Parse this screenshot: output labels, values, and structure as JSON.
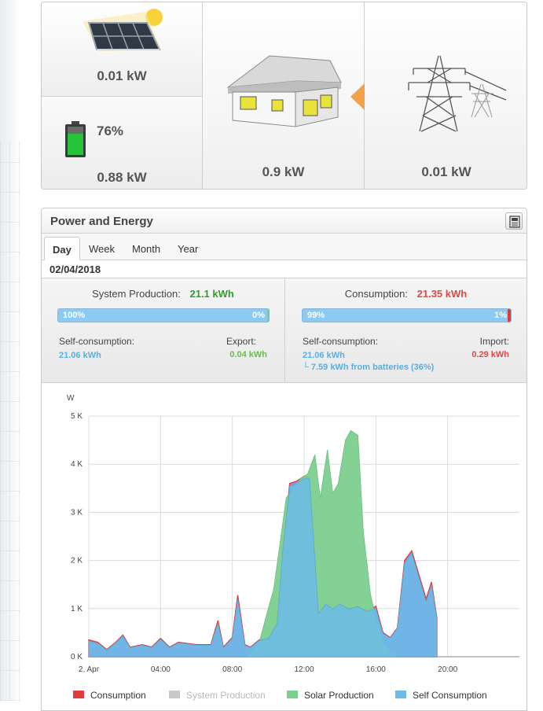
{
  "flow": {
    "solar_value": "0.01 kW",
    "battery_percent": "76%",
    "battery_value": "0.88 kW",
    "house_value": "0.9 kW",
    "grid_value": "0.01 kW"
  },
  "panel": {
    "title": "Power and Energy",
    "tabs": [
      "Day",
      "Week",
      "Month",
      "Year"
    ],
    "active_tab": "Day",
    "date": "02/04/2018"
  },
  "production": {
    "label": "System Production:",
    "value": "21.1 kWh",
    "bar_left": "100%",
    "bar_right": "0%",
    "self_label": "Self-consumption:",
    "self_value": "21.06 kWh",
    "export_label": "Export:",
    "export_value": "0.04 kWh"
  },
  "consumption": {
    "label": "Consumption:",
    "value": "21.35 kWh",
    "bar_left": "99%",
    "bar_right": "1%",
    "self_label": "Self-consumption:",
    "self_value": "21.06 kWh",
    "battery_note": "└ 7.59 kWh from batteries (36%)",
    "import_label": "Import:",
    "import_value": "0.29 kWh"
  },
  "colors": {
    "consumption": "#e03c3c",
    "system_production": "#c8c8c8",
    "solar_production": "#7ccf8f",
    "self_consumption": "#6bbbe9",
    "green_text": "#2e9e2e",
    "red_text": "#e04848",
    "blue_text": "#5aaee0",
    "lightgreen_text": "#6dbb4a"
  },
  "chart_data": {
    "type": "area",
    "ylabel": "W",
    "y_ticks": [
      "0 K",
      "1 K",
      "2 K",
      "3 K",
      "4 K",
      "5 K"
    ],
    "ylim": [
      0,
      5000
    ],
    "x_ticks": [
      "2. Apr",
      "04:00",
      "08:00",
      "12:00",
      "16:00",
      "20:00"
    ],
    "xlim": [
      0,
      24
    ],
    "legend": [
      "Consumption",
      "System Production",
      "Solar Production",
      "Self Consumption"
    ],
    "series": [
      {
        "name": "Consumption",
        "x": [
          0,
          0.5,
          1,
          1.5,
          1.9,
          2.3,
          3,
          3.5,
          4,
          4.5,
          5,
          6,
          6.8,
          7.2,
          7.5,
          8,
          8.3,
          8.7,
          9,
          9.5,
          10,
          10.5,
          10.8,
          11.2,
          11.6,
          12,
          12.3,
          12.8,
          13.2,
          13.6,
          14,
          14.5,
          15,
          15.5,
          16,
          16.4,
          16.8,
          17.2,
          17.6,
          18,
          18.4,
          18.8,
          19.1,
          19.4
        ],
        "y": [
          350,
          300,
          150,
          300,
          450,
          200,
          250,
          200,
          380,
          200,
          300,
          250,
          250,
          750,
          200,
          400,
          1280,
          250,
          200,
          350,
          380,
          700,
          2200,
          3600,
          3650,
          3750,
          3720,
          900,
          1100,
          1000,
          1100,
          1000,
          1050,
          950,
          1050,
          500,
          400,
          600,
          2000,
          2200,
          1700,
          1200,
          1550,
          800
        ]
      },
      {
        "name": "Solar Production",
        "x": [
          8.8,
          9.5,
          10,
          10.3,
          10.6,
          11,
          11.4,
          11.8,
          12.2,
          12.6,
          12.9,
          13.3,
          13.6,
          13.9,
          14.3,
          14.6,
          15,
          15.3,
          15.7,
          16,
          16.4,
          16.8,
          17.2
        ],
        "y": [
          0,
          300,
          1000,
          1400,
          2200,
          3300,
          3500,
          3700,
          3800,
          4200,
          3300,
          4300,
          3400,
          3600,
          4500,
          4700,
          4600,
          2600,
          1300,
          800,
          300,
          100,
          0
        ]
      },
      {
        "name": "Self Consumption",
        "x": [
          0,
          0.5,
          1,
          1.5,
          1.9,
          2.3,
          3,
          3.5,
          4,
          4.5,
          5,
          6,
          6.8,
          7.2,
          7.5,
          8,
          8.3,
          8.7,
          9,
          9.5,
          10,
          10.5,
          10.8,
          11.2,
          11.6,
          12,
          12.3,
          12.8,
          13.2,
          13.6,
          14,
          14.5,
          15,
          15.5,
          16,
          16.4,
          16.8,
          17.2,
          17.6,
          18,
          18.4,
          18.8,
          19.1,
          19.4
        ],
        "y": [
          330,
          280,
          140,
          290,
          430,
          190,
          240,
          190,
          360,
          190,
          290,
          240,
          240,
          700,
          190,
          380,
          1200,
          240,
          190,
          340,
          370,
          690,
          2150,
          3550,
          3600,
          3700,
          3700,
          890,
          1090,
          990,
          1090,
          990,
          1040,
          940,
          1000,
          480,
          390,
          590,
          1950,
          2150,
          1650,
          1150,
          1500,
          780
        ]
      }
    ]
  }
}
